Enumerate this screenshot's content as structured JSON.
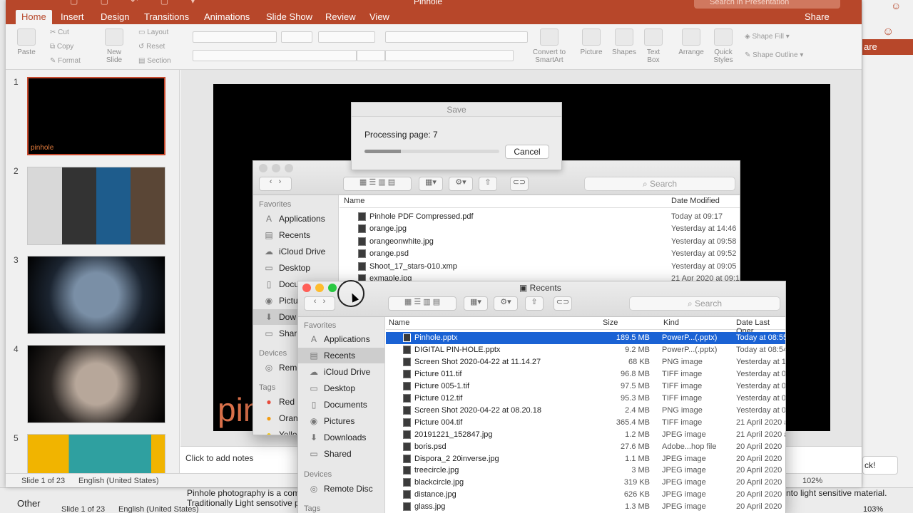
{
  "colors": {
    "brand": "#b7472a",
    "selection": "#1a62d4",
    "slide_text": "#d9704a"
  },
  "ppt": {
    "title": "Pinhole",
    "search_placeholder": "Search in Presentation",
    "share": "Share",
    "tabs": [
      "Home",
      "Insert",
      "Design",
      "Transitions",
      "Animations",
      "Slide Show",
      "Review",
      "View"
    ],
    "ribbon": {
      "paste": "Paste",
      "cut": "Cut",
      "copy": "Copy",
      "format": "Format",
      "new_slide": "New\nSlide",
      "layout": "Layout",
      "reset": "Reset",
      "section": "Section",
      "convert": "Convert to\nSmartArt",
      "picture": "Picture",
      "shapes": "Shapes",
      "textbox": "Text\nBox",
      "arrange": "Arrange",
      "quick_styles": "Quick\nStyles",
      "shape_fill": "Shape Fill",
      "shape_outline": "Shape Outline"
    },
    "thumbnails": [
      {
        "num": "1",
        "title": "pinhole",
        "selected": true
      },
      {
        "num": "2"
      },
      {
        "num": "3"
      },
      {
        "num": "4"
      },
      {
        "num": "5"
      }
    ],
    "slide_title_fragment": "pin",
    "notes_placeholder": "Click to add notes",
    "status_slide": "Slide 1 of 23",
    "status_lang": "English (United States)",
    "zoom": "102%"
  },
  "background": {
    "share_strip": "are",
    "bubble": "ck!",
    "other": "Other",
    "notes_line1": "Pinhole photography is a com",
    "notes_line2": "Traditionally Light sensotive p",
    "notes_right": "nto light sensitive material.",
    "status_slide": "Slide 1 of 23",
    "status_lang": "English (United States)",
    "zoom": "103%"
  },
  "save_dialog": {
    "title": "Save",
    "message": "Processing page: 7",
    "progress_fraction": 0.27,
    "cancel": "Cancel"
  },
  "finder_back": {
    "search": "Search",
    "sidebar_heads": [
      "Favorites",
      "Devices",
      "Tags"
    ],
    "sidebar_items": [
      "Applications",
      "Recents",
      "iCloud Drive",
      "Desktop",
      "Docu",
      "Pictu",
      "Dow",
      "Share",
      "Remo",
      "Red",
      "Oran",
      "Yello"
    ],
    "columns": {
      "name": "Name",
      "date": "Date Modified"
    },
    "rows": [
      {
        "name": "Pinhole PDF Compressed.pdf",
        "date": "Today at 09:17"
      },
      {
        "name": "orange.jpg",
        "date": "Yesterday at 14:46"
      },
      {
        "name": "orangeonwhite.jpg",
        "date": "Yesterday at 09:58"
      },
      {
        "name": "orange.psd",
        "date": "Yesterday at 09:52"
      },
      {
        "name": "Shoot_17_stars-010.xmp",
        "date": "Yesterday at 09:05"
      },
      {
        "name": "exmaple.jpg",
        "date": "21 Apr 2020 at 09:1"
      }
    ]
  },
  "finder_front": {
    "title": "Recents",
    "search": "Search",
    "sidebar_heads": [
      "Favorites",
      "Devices",
      "Tags"
    ],
    "sidebar_items": [
      "Applications",
      "Recents",
      "iCloud Drive",
      "Desktop",
      "Documents",
      "Pictures",
      "Downloads",
      "Shared",
      "Remote Disc"
    ],
    "columns": {
      "name": "Name",
      "size": "Size",
      "kind": "Kind",
      "date": "Date Last Oper"
    },
    "rows": [
      {
        "name": "Pinhole.pptx",
        "size": "189.5 MB",
        "kind": "PowerP...(.pptx)",
        "date": "Today at 08:55",
        "selected": true
      },
      {
        "name": "DIGITAL PIN-HOLE.pptx",
        "size": "9.2 MB",
        "kind": "PowerP...(.pptx)",
        "date": "Today at 08:54"
      },
      {
        "name": "Screen Shot 2020-04-22 at 11.14.27",
        "size": "68 KB",
        "kind": "PNG image",
        "date": "Yesterday at 1"
      },
      {
        "name": "Picture 011.tif",
        "size": "96.8 MB",
        "kind": "TIFF image",
        "date": "Yesterday at 0"
      },
      {
        "name": "Picture 005-1.tif",
        "size": "97.5 MB",
        "kind": "TIFF image",
        "date": "Yesterday at 0"
      },
      {
        "name": "Picture 012.tif",
        "size": "95.3 MB",
        "kind": "TIFF image",
        "date": "Yesterday at 0"
      },
      {
        "name": "Screen Shot 2020-04-22 at 08.20.18",
        "size": "2.4 MB",
        "kind": "PNG image",
        "date": "Yesterday at 0"
      },
      {
        "name": "Picture 004.tif",
        "size": "365.4 MB",
        "kind": "TIFF image",
        "date": "21 April 2020 at"
      },
      {
        "name": "20191221_152847.jpg",
        "size": "1.2 MB",
        "kind": "JPEG image",
        "date": "21 April 2020 a"
      },
      {
        "name": "boris.psd",
        "size": "27.6 MB",
        "kind": "Adobe...hop file",
        "date": "20 April 2020"
      },
      {
        "name": "Dispora_2 20inverse.jpg",
        "size": "1.1 MB",
        "kind": "JPEG image",
        "date": "20 April 2020"
      },
      {
        "name": "treecircle.jpg",
        "size": "3 MB",
        "kind": "JPEG image",
        "date": "20 April 2020"
      },
      {
        "name": "blackcircle.jpg",
        "size": "319 KB",
        "kind": "JPEG image",
        "date": "20 April 2020"
      },
      {
        "name": "distance.jpg",
        "size": "626 KB",
        "kind": "JPEG image",
        "date": "20 April 2020"
      },
      {
        "name": "glass.jpg",
        "size": "1.3 MB",
        "kind": "JPEG image",
        "date": "20 April 2020"
      }
    ]
  }
}
